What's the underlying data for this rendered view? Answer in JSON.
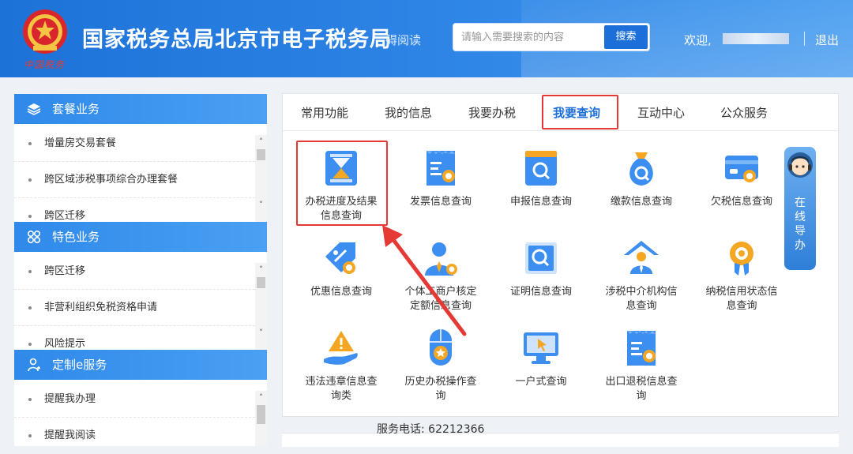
{
  "header": {
    "site_title": "国家税务总局北京市电子税务局",
    "motto": "中国税务",
    "accessibility": "碍阅读",
    "search_placeholder": "请输入需要搜索的内容",
    "search_button": "搜索",
    "welcome": "欢迎,",
    "logout": "退出"
  },
  "sidebar": {
    "sections": [
      {
        "title": "套餐业务",
        "icon": "layers-icon",
        "items": [
          "增量房交易套餐",
          "跨区域涉税事项综合办理套餐",
          "跨区迁移"
        ]
      },
      {
        "title": "特色业务",
        "icon": "grid-icon",
        "items": [
          "跨区迁移",
          "非营利组织免税资格申请",
          "风险提示"
        ]
      },
      {
        "title": "定制e服务",
        "icon": "user-plus-icon",
        "items": [
          "提醒我办理",
          "提醒我阅读"
        ]
      }
    ]
  },
  "tabs": [
    "常用功能",
    "我的信息",
    "我要办税",
    "我要查询",
    "互动中心",
    "公众服务"
  ],
  "active_tab": "我要查询",
  "functions": [
    {
      "line1": "办税进度及结果",
      "line2": "信息查询",
      "icon": "hourglass-icon"
    },
    {
      "line1": "发票信息查询",
      "line2": "",
      "icon": "invoice-search-icon"
    },
    {
      "line1": "申报信息查询",
      "line2": "",
      "icon": "declaration-search-icon"
    },
    {
      "line1": "缴款信息查询",
      "line2": "",
      "icon": "money-bag-search-icon"
    },
    {
      "line1": "欠税信息查询",
      "line2": "",
      "icon": "card-search-icon"
    },
    {
      "line1": "优惠信息查询",
      "line2": "",
      "icon": "discount-tag-icon"
    },
    {
      "line1": "个体工商户核定",
      "line2": "定额信息查询",
      "icon": "person-search-icon"
    },
    {
      "line1": "证明信息查询",
      "line2": "",
      "icon": "certificate-search-icon"
    },
    {
      "line1": "涉税中介机构信",
      "line2": "息查询",
      "icon": "agency-house-icon"
    },
    {
      "line1": "纳税信用状态信",
      "line2": "息查询",
      "icon": "credit-medal-icon"
    },
    {
      "line1": "违法违章信息查",
      "line2": "询类",
      "icon": "warning-hand-icon"
    },
    {
      "line1": "历史办税操作查",
      "line2": "询",
      "icon": "mouse-star-icon"
    },
    {
      "line1": "一户式查询",
      "line2": "",
      "icon": "monitor-cursor-icon"
    },
    {
      "line1": "出口退税信息查",
      "line2": "询",
      "icon": "export-refund-icon"
    }
  ],
  "online_guide": "在线导办",
  "service_phone": "服务电话: 62212366",
  "colors": {
    "brand_blue": "#1c6fd9",
    "highlight_red": "#e53935",
    "icon_blue": "#2e86e8",
    "icon_orange": "#f5a623"
  }
}
